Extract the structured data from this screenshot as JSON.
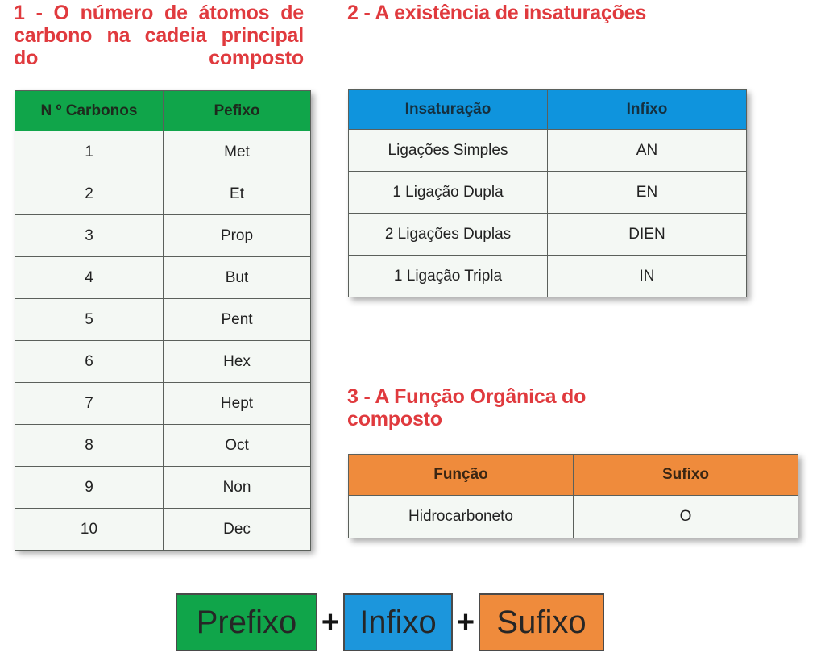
{
  "sections": {
    "one": {
      "title": "1 - O número de átomos de carbono na cadeia principal do composto",
      "table": {
        "headers": [
          "N º Carbonos",
          "Pefixo"
        ],
        "header_color": "#10a54a",
        "rows": [
          [
            "1",
            "Met"
          ],
          [
            "2",
            "Et"
          ],
          [
            "3",
            "Prop"
          ],
          [
            "4",
            "But"
          ],
          [
            "5",
            "Pent"
          ],
          [
            "6",
            "Hex"
          ],
          [
            "7",
            "Hept"
          ],
          [
            "8",
            "Oct"
          ],
          [
            "9",
            "Non"
          ],
          [
            "10",
            "Dec"
          ]
        ]
      }
    },
    "two": {
      "title": "2 - A existência de insaturações",
      "table": {
        "headers": [
          "Insaturação",
          "Infixo"
        ],
        "header_color": "#0f94dd",
        "rows": [
          [
            "Ligações Simples",
            "AN"
          ],
          [
            "1 Ligação Dupla",
            "EN"
          ],
          [
            "2 Ligações Duplas",
            "DIEN"
          ],
          [
            "1 Ligação Tripla",
            "IN"
          ]
        ]
      }
    },
    "three": {
      "title": "3 - A Função Orgânica do composto",
      "table": {
        "headers": [
          "Função",
          "Sufixo"
        ],
        "header_color": "#ef8b3c",
        "rows": [
          [
            "Hidrocarboneto",
            "O"
          ]
        ]
      }
    }
  },
  "formula": {
    "prefix_label": "Prefixo",
    "infix_label": "Infixo",
    "suffix_label": "Sufixo",
    "operator_1": "+",
    "operator_2": "+",
    "prefix_color": "#10a54a",
    "infix_color": "#1c96dc",
    "suffix_color": "#ef8b3c"
  },
  "colors": {
    "title_red": "#e03a3e",
    "cell_background": "#f4f8f4",
    "border": "#5b605b"
  }
}
